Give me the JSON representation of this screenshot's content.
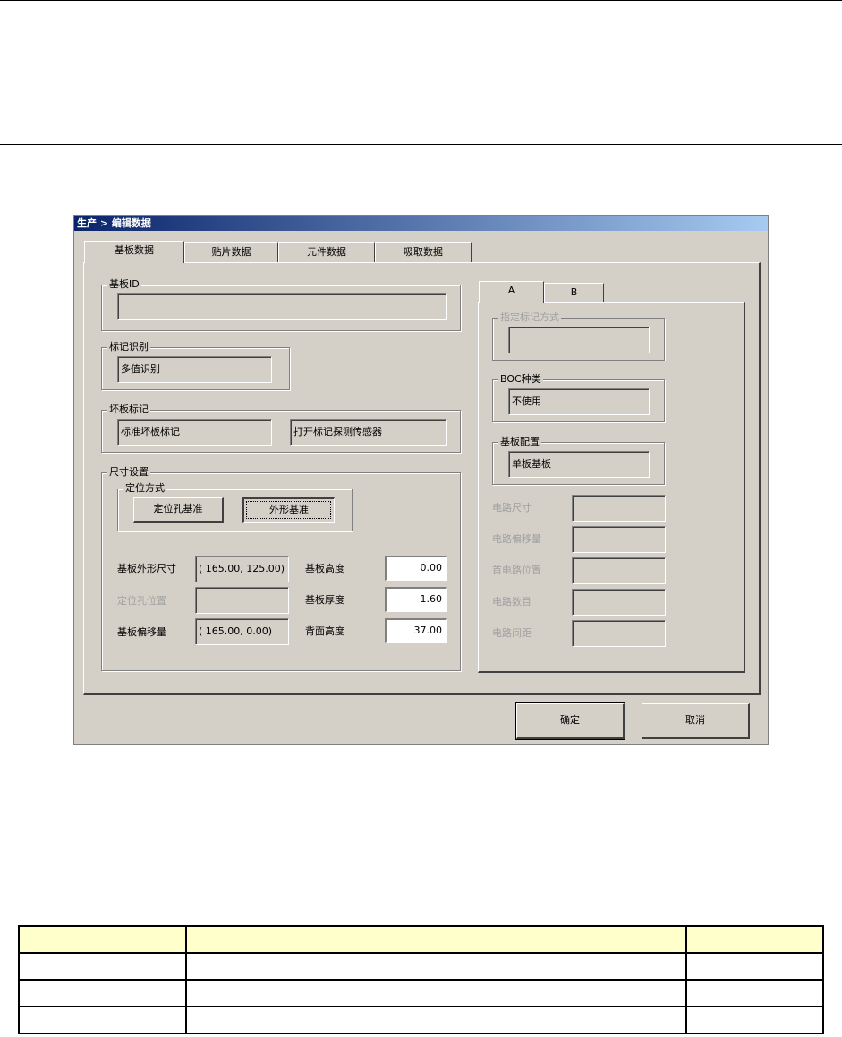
{
  "window": {
    "title": "生产 > 编辑数据"
  },
  "main_tabs": [
    "基板数据",
    "贴片数据",
    "元件数据",
    "吸取数据"
  ],
  "board_id": {
    "label": "基板ID",
    "value": ""
  },
  "mark_recognition": {
    "label": "标记识别",
    "value": "多值识别"
  },
  "bad_mark": {
    "label": "坏板标记",
    "value1": "标准坏板标记",
    "value2": "打开标记探测传感器"
  },
  "size_settings": {
    "label": "尺寸设置",
    "positioning": {
      "label": "定位方式",
      "btn1": "定位孔基准",
      "btn2": "外形基准"
    },
    "board_outline_label": "基板外形尺寸",
    "board_outline_value": "( 165.00, 125.00)",
    "hole_pos_label": "定位孔位置",
    "hole_pos_value": "",
    "board_offset_label": "基板偏移量",
    "board_offset_value": "( 165.00,    0.00)",
    "board_height_label": "基板高度",
    "board_height_value": "0.00",
    "board_thickness_label": "基板厚度",
    "board_thickness_value": "1.60",
    "back_height_label": "背面高度",
    "back_height_value": "37.00"
  },
  "side_tabs": [
    "A",
    "B"
  ],
  "side_panel": {
    "mark_method_label": "指定标记方式",
    "mark_method_value": "",
    "boc_label": "BOC种类",
    "boc_value": "不使用",
    "board_config_label": "基板配置",
    "board_config_value": "单板基板",
    "circuit_size_label": "电路尺寸",
    "circuit_offset_label": "电路偏移量",
    "first_circuit_pos_label": "首电路位置",
    "circuit_count_label": "电路数目",
    "circuit_pitch_label": "电路间距"
  },
  "buttons": {
    "ok": "确定",
    "cancel": "取消"
  }
}
